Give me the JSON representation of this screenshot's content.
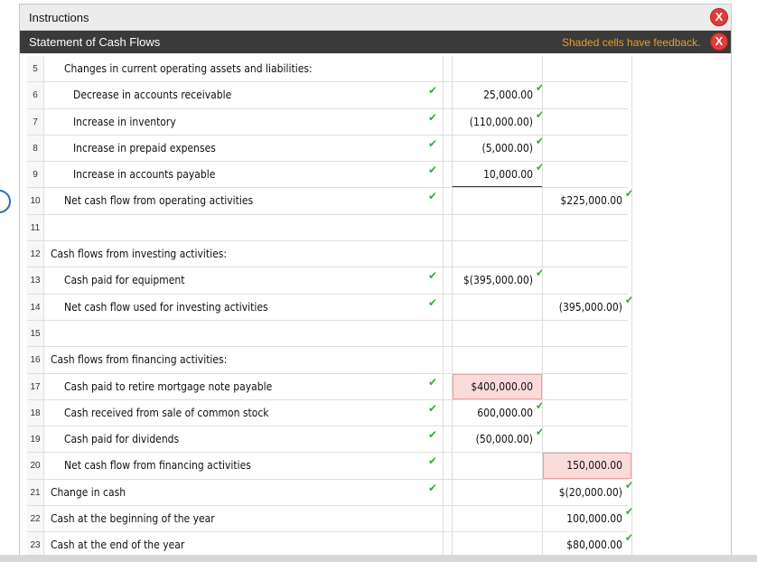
{
  "window": {
    "title": "Instructions",
    "header_title": "Statement of Cash Flows",
    "feedback_note": "Shaded cells have feedback.",
    "close_glyph": "X"
  },
  "colors": {
    "accent_error": "#e03c3c",
    "feedback_orange": "#f09a2a",
    "check_green": "#3aa83a",
    "pink_cell": "#fbdada"
  },
  "check_glyph": "✔",
  "rows": [
    {
      "num": "5",
      "label": "Changes in current operating assets and liabilities:",
      "indent": 2,
      "check": false,
      "a": "",
      "b": ""
    },
    {
      "num": "6",
      "label": "Decrease in accounts receivable",
      "indent": 3,
      "check": true,
      "a": "25,000.00",
      "b": ""
    },
    {
      "num": "7",
      "label": "Increase in inventory",
      "indent": 3,
      "check": true,
      "a": "(110,000.00)",
      "b": ""
    },
    {
      "num": "8",
      "label": "Increase in prepaid expenses",
      "indent": 3,
      "check": true,
      "a": "(5,000.00)",
      "b": ""
    },
    {
      "num": "9",
      "label": "Increase in accounts payable",
      "indent": 3,
      "check": true,
      "a": "10,000.00",
      "b": ""
    },
    {
      "num": "10",
      "label": "Net cash flow from operating activities",
      "indent": 2,
      "check": true,
      "a": "",
      "b": "$225,000.00"
    },
    {
      "num": "11",
      "label": "",
      "indent": 1,
      "check": false,
      "a": "",
      "b": ""
    },
    {
      "num": "12",
      "label": "Cash flows from investing activities:",
      "indent": 1,
      "check": false,
      "a": "",
      "b": ""
    },
    {
      "num": "13",
      "label": "Cash paid for equipment",
      "indent": 2,
      "check": true,
      "a": "$(395,000.00)",
      "b": ""
    },
    {
      "num": "14",
      "label": "Net cash flow used for investing activities",
      "indent": 2,
      "check": true,
      "a": "",
      "b": "(395,000.00)"
    },
    {
      "num": "15",
      "label": "",
      "indent": 1,
      "check": false,
      "a": "",
      "b": ""
    },
    {
      "num": "16",
      "label": "Cash flows from financing activities:",
      "indent": 1,
      "check": false,
      "a": "",
      "b": ""
    },
    {
      "num": "17",
      "label": "Cash paid to retire mortgage note payable",
      "indent": 2,
      "check": true,
      "a": "$400,000.00",
      "b": ""
    },
    {
      "num": "18",
      "label": "Cash received from sale of common stock",
      "indent": 2,
      "check": true,
      "a": "600,000.00",
      "b": ""
    },
    {
      "num": "19",
      "label": "Cash paid for dividends",
      "indent": 2,
      "check": true,
      "a": "(50,000.00)",
      "b": ""
    },
    {
      "num": "20",
      "label": "Net cash flow from financing activities",
      "indent": 2,
      "check": true,
      "a": "",
      "b": "150,000.00"
    },
    {
      "num": "21",
      "label": "Change in cash",
      "indent": 1,
      "check": true,
      "a": "",
      "b": "$(20,000.00)"
    },
    {
      "num": "22",
      "label": "Cash at the beginning of the year",
      "indent": 1,
      "check": false,
      "a": "",
      "b": "100,000.00"
    },
    {
      "num": "23",
      "label": "Cash at the end of the year",
      "indent": 1,
      "check": false,
      "a": "",
      "b": "$80,000.00"
    }
  ]
}
